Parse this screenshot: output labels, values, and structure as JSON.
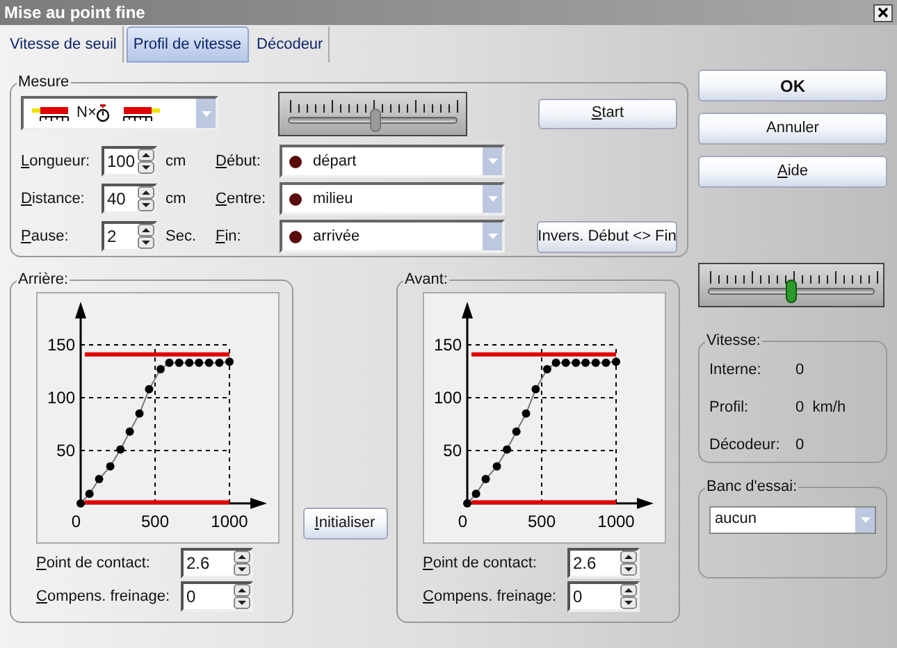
{
  "window": {
    "title": "Mise au point fine"
  },
  "tabs": [
    {
      "label": "Vitesse de seuil",
      "selected": false
    },
    {
      "label": "Profil de vitesse",
      "selected": true
    },
    {
      "label": "Décodeur",
      "selected": false
    }
  ],
  "measure": {
    "title": "Mesure",
    "mode_label": "N×",
    "slider": {
      "level": 0.52
    },
    "start_button": "Start",
    "rows": [
      {
        "label": "Longueur:",
        "value": "100",
        "unit": "cm",
        "point_label": "Début:",
        "point": "départ"
      },
      {
        "label": "Distance:",
        "value": "40",
        "unit": "cm",
        "point_label": "Centre:",
        "point": "milieu"
      },
      {
        "label": "Pause:",
        "value": "2",
        "unit": "Sec.",
        "point_label": "Fin:",
        "point": "arrivée"
      }
    ],
    "swap_button": "Invers. Début <> Fin"
  },
  "profiles": [
    {
      "title": "Arrière:",
      "chart_data": {
        "type": "line",
        "x": [
          0,
          59,
          124,
          199,
          267,
          330,
          395,
          460,
          537,
          596,
          662,
          730,
          795,
          863,
          932,
          1000
        ],
        "series": [
          {
            "color": "#000000",
            "marker": "o",
            "values": [
              0,
              9,
              23,
              35,
              51,
              68,
              85,
              108,
              127,
              133,
              133,
              133,
              133,
              133,
              133,
              134
            ]
          }
        ],
        "xlim": [
          0,
          1000
        ],
        "ylim": [
          0,
          150
        ],
        "xticks": [
          0,
          500,
          1000
        ],
        "yticks": [
          50,
          100,
          150
        ],
        "grid": true,
        "ref_lines": [
          {
            "axis": "y",
            "value": 141,
            "color": "#e00000"
          },
          {
            "axis": "y",
            "value": 1,
            "color": "#e00000"
          }
        ]
      },
      "fields": [
        {
          "label": "Point de contact:",
          "value": "2.6"
        },
        {
          "label": "Compens. freinage:",
          "value": "0"
        }
      ]
    },
    {
      "title": "Avant:",
      "chart_data": {
        "type": "line",
        "x": [
          0,
          59,
          124,
          199,
          267,
          330,
          395,
          460,
          537,
          596,
          662,
          730,
          795,
          863,
          932,
          1000
        ],
        "series": [
          {
            "color": "#000000",
            "marker": "o",
            "values": [
              0,
              9,
              23,
              35,
              51,
              68,
              85,
              108,
              127,
              133,
              133,
              133,
              133,
              133,
              133,
              134
            ]
          }
        ],
        "xlim": [
          0,
          1000
        ],
        "ylim": [
          0,
          150
        ],
        "xticks": [
          0,
          500,
          1000
        ],
        "yticks": [
          50,
          100,
          150
        ],
        "grid": true,
        "ref_lines": [
          {
            "axis": "y",
            "value": 141,
            "color": "#e00000"
          },
          {
            "axis": "y",
            "value": 1,
            "color": "#e00000"
          }
        ]
      },
      "fields": [
        {
          "label": "Point de contact:",
          "value": "2.6"
        },
        {
          "label": "Compens. freinage:",
          "value": "0"
        }
      ]
    }
  ],
  "reset_button": "Initialiser",
  "buttons": [
    {
      "label": "OK",
      "default": true
    },
    {
      "label": "Annuler",
      "default": false
    },
    {
      "label": "Aide",
      "default": false
    }
  ],
  "speed_slider": {
    "level": 0.5
  },
  "speed": {
    "title": "Vitesse:",
    "rows": [
      {
        "label": "Interne:",
        "value": "0"
      },
      {
        "label": "Profil:",
        "value": "0  km/h"
      },
      {
        "label": "Décodeur:",
        "value": "0"
      }
    ]
  },
  "test_bench": {
    "title": "Banc d'essai:",
    "value": "aucun"
  }
}
